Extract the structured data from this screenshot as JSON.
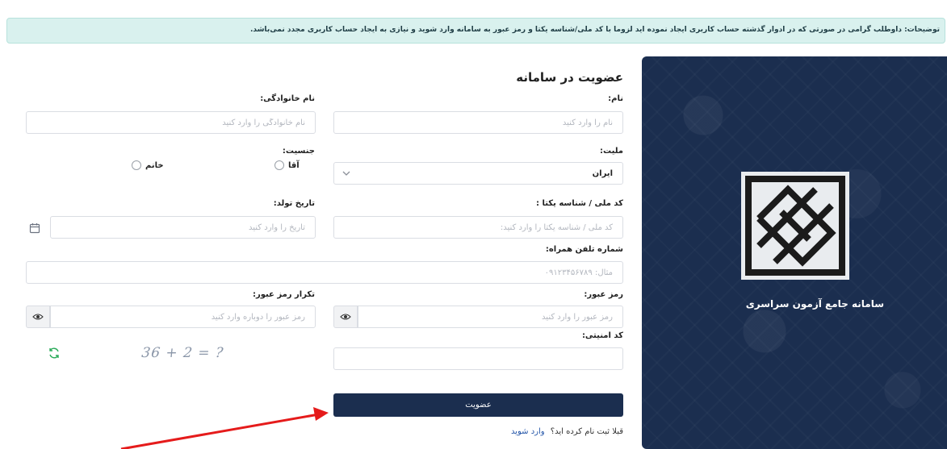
{
  "notice": {
    "text": "توضیحات: داوطلب گرامی در صورتی که در ادوار گذشته حساب کاربری ایجاد نموده اید لزوما با کد ملی/شناسه یکتا و رمز عبور به سامانه وارد شوید و نیازی به ایجاد حساب کاربری مجدد نمی‌باشد."
  },
  "brand": {
    "title": "سامانه جامع آزمون سراسری"
  },
  "form": {
    "title": "عضویت در سامانه",
    "first_name": {
      "label": "نام:",
      "placeholder": "نام را وارد کنید"
    },
    "last_name": {
      "label": "نام خانوادگی:",
      "placeholder": "نام خانوادگی را وارد کنید"
    },
    "nationality": {
      "label": "ملیت:",
      "value": "ایران"
    },
    "gender": {
      "label": "جنسیت:",
      "options": [
        "آقا",
        "خانم"
      ]
    },
    "national_id": {
      "label": "کد ملی / شناسه یکتا :",
      "placeholder": "کد ملی / شناسه یکتا را وارد کنید:"
    },
    "birth_date": {
      "label": "تاریخ تولد:",
      "placeholder": "تاریخ را وارد کنید"
    },
    "phone": {
      "label": "شماره تلفن همراه:",
      "placeholder": "مثال: ۰۹۱۲۳۴۵۶۷۸۹"
    },
    "password": {
      "label": "رمز عبور:",
      "placeholder": "رمز عبور را وارد کنید"
    },
    "password_repeat": {
      "label": "تکرار رمز عبور:",
      "placeholder": "رمز عبور را دوباره وارد کنید"
    },
    "captcha": {
      "label": "کد امنیتی:",
      "image_text": "36 + 2 = ?"
    },
    "submit_label": "عضویت",
    "login_prompt": "قبلا ثبت نام کرده اید؟",
    "login_link": "وارد شوید"
  },
  "colors": {
    "primary": "#1b2e4f",
    "notice_bg": "#d9f1ee",
    "annotation_arrow": "#e51b1b",
    "refresh": "#2bab5a"
  }
}
